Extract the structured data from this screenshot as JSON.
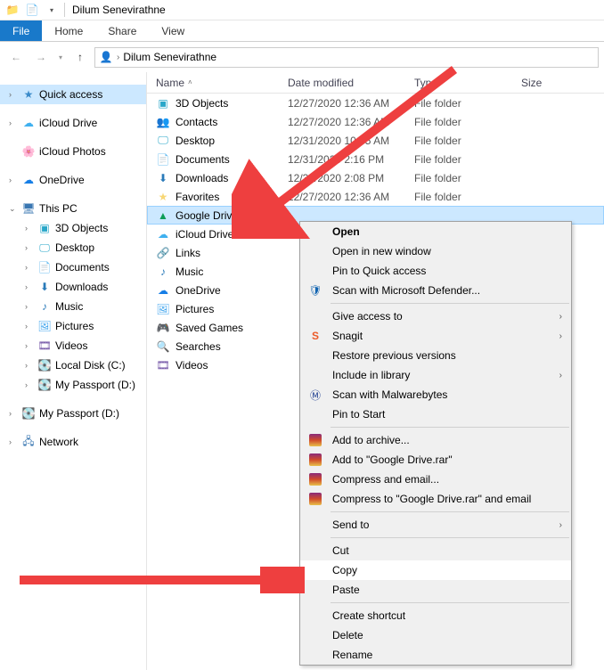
{
  "title": "Dilum Senevirathne",
  "ribbon": {
    "file": "File",
    "tabs": [
      "Home",
      "Share",
      "View"
    ]
  },
  "addressbar": {
    "root": "",
    "seg1": "Dilum Senevirathne"
  },
  "columns": {
    "name": "Name",
    "date": "Date modified",
    "type": "Type",
    "size": "Size"
  },
  "sidebar": {
    "quick": "Quick access",
    "icloud_drive": "iCloud Drive",
    "icloud_photos": "iCloud Photos",
    "onedrive": "OneDrive",
    "this_pc": "This PC",
    "pc_children": [
      "3D Objects",
      "Desktop",
      "Documents",
      "Downloads",
      "Music",
      "Pictures",
      "Videos",
      "Local Disk (C:)",
      "My Passport (D:)"
    ],
    "my_passport": "My Passport (D:)",
    "network": "Network"
  },
  "rows": [
    {
      "name": "3D Objects",
      "date": "12/27/2020 12:36 AM",
      "type": "File folder"
    },
    {
      "name": "Contacts",
      "date": "12/27/2020 12:36 AM",
      "type": "File folder"
    },
    {
      "name": "Desktop",
      "date": "12/31/2020 10:35 AM",
      "type": "File folder"
    },
    {
      "name": "Documents",
      "date": "12/31/2020 2:16 PM",
      "type": "File folder"
    },
    {
      "name": "Downloads",
      "date": "12/31/2020 2:08 PM",
      "type": "File folder"
    },
    {
      "name": "Favorites",
      "date": "12/27/2020 12:36 AM",
      "type": "File folder"
    },
    {
      "name": "Google Drive",
      "date": "",
      "type": ""
    },
    {
      "name": "iCloud Drive",
      "date": "",
      "type": ""
    },
    {
      "name": "Links",
      "date": "",
      "type": ""
    },
    {
      "name": "Music",
      "date": "",
      "type": ""
    },
    {
      "name": "OneDrive",
      "date": "",
      "type": ""
    },
    {
      "name": "Pictures",
      "date": "",
      "type": ""
    },
    {
      "name": "Saved Games",
      "date": "",
      "type": ""
    },
    {
      "name": "Searches",
      "date": "",
      "type": ""
    },
    {
      "name": "Videos",
      "date": "",
      "type": ""
    }
  ],
  "ctx": {
    "open": "Open",
    "open_new": "Open in new window",
    "pin_quick": "Pin to Quick access",
    "defender": "Scan with Microsoft Defender...",
    "give_access": "Give access to",
    "snagit": "Snagit",
    "restore": "Restore previous versions",
    "include": "Include in library",
    "mwb": "Scan with Malwarebytes",
    "pin_start": "Pin to Start",
    "archive": "Add to archive...",
    "add_rar": "Add to \"Google Drive.rar\"",
    "compress_email": "Compress and email...",
    "compress_rar_email": "Compress to \"Google Drive.rar\" and email",
    "send_to": "Send to",
    "cut": "Cut",
    "copy": "Copy",
    "paste": "Paste",
    "shortcut": "Create shortcut",
    "delete": "Delete",
    "rename": "Rename"
  }
}
